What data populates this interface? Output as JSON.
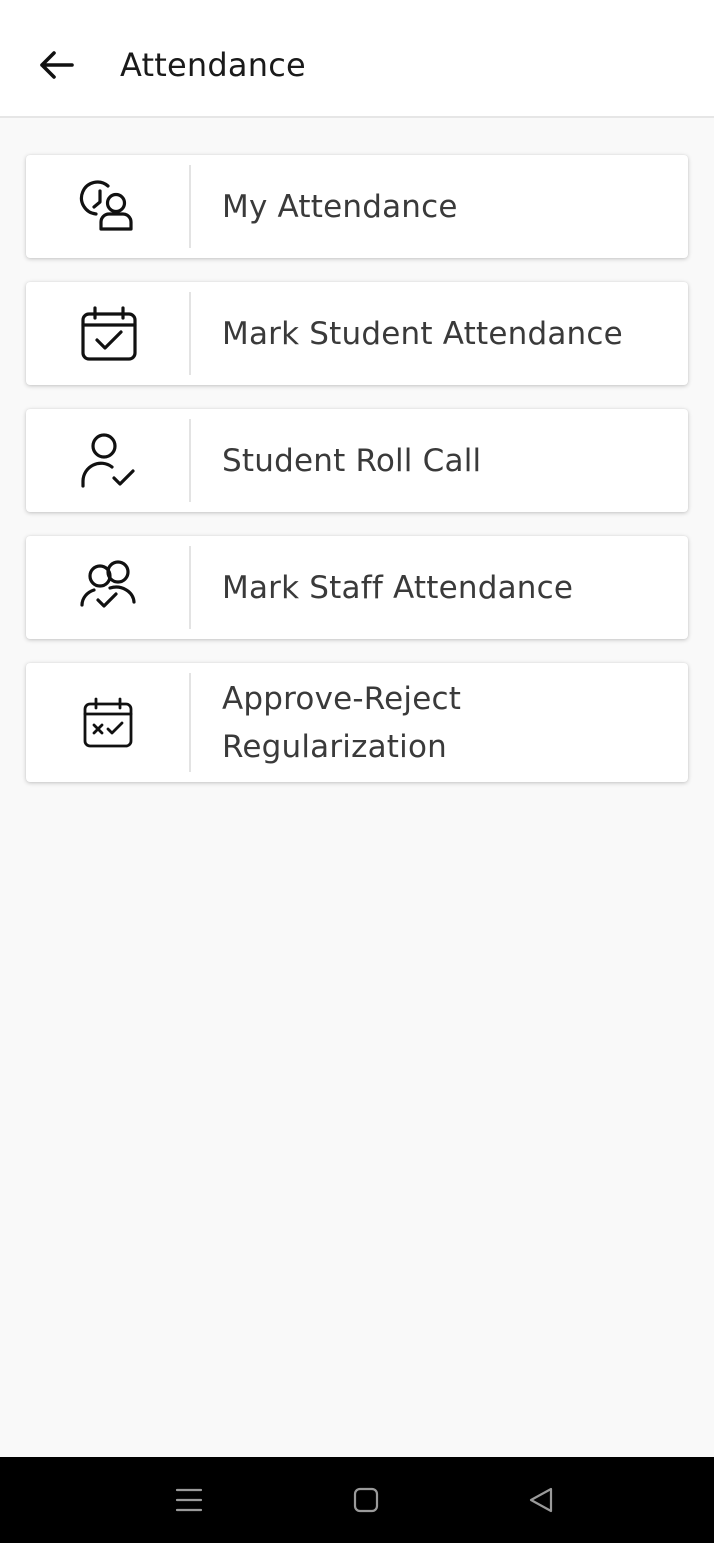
{
  "header": {
    "title": "Attendance",
    "back_icon": "arrow-left-icon"
  },
  "menu": {
    "items": [
      {
        "id": "my-attendance",
        "icon": "user-clock-icon",
        "label": [
          "My Attendance"
        ]
      },
      {
        "id": "mark-student-attendance",
        "icon": "calendar-check-icon",
        "label": [
          "Mark Student Attendance"
        ]
      },
      {
        "id": "student-roll-call",
        "icon": "user-check-icon",
        "label": [
          "Student Roll Call"
        ]
      },
      {
        "id": "mark-staff-attendance",
        "icon": "users-check-icon",
        "label": [
          "Mark Staff Attendance"
        ]
      },
      {
        "id": "approve-reject-regularization",
        "icon": "calendar-x-check-icon",
        "label": [
          "Approve-Reject",
          "Regularization"
        ]
      }
    ]
  },
  "system_nav": {
    "buttons": [
      "recent-apps-icon",
      "home-icon",
      "back-triangle-icon"
    ]
  },
  "colors": {
    "background": "#f9f9f9",
    "card": "#ffffff",
    "text": "#3a3a3a",
    "title": "#1a1a1a",
    "navbar": "#000000"
  }
}
